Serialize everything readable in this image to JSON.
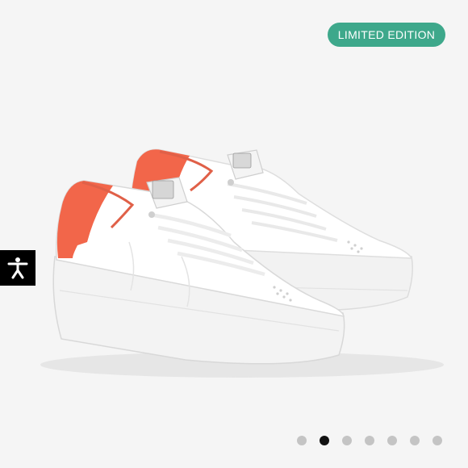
{
  "badge": {
    "label": "LIMITED EDITION",
    "color": "#3ea88b"
  },
  "product_image": {
    "subject": "sneakers-pair",
    "colors": {
      "upper": "#ffffff",
      "heel_tab": "#f2664a",
      "sole": "#f4f4f4",
      "background": "#f5f5f5"
    }
  },
  "accessibility": {
    "icon": "accessibility-person-icon"
  },
  "carousel": {
    "total": 7,
    "active_index": 1
  }
}
